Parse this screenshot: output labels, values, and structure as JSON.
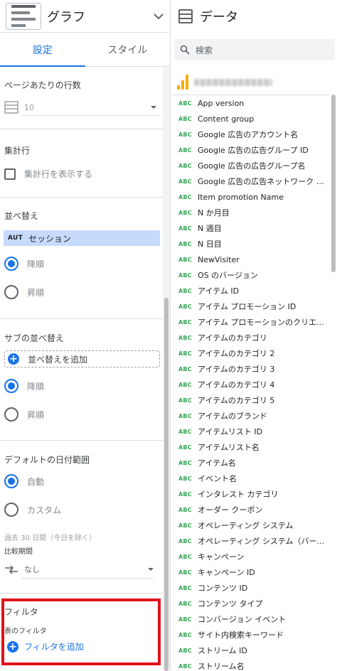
{
  "header": {
    "title": "グラフ"
  },
  "tabs": [
    {
      "label": "設定"
    },
    {
      "label": "スタイル"
    }
  ],
  "rows_per_page": {
    "label": "ページあたりの行数",
    "value": "10"
  },
  "summary_row": {
    "label": "集計行",
    "checkbox_label": "集計行を表示する"
  },
  "sort": {
    "label": "並べ替え",
    "chip_type": "AUT",
    "chip_label": "セッション",
    "desc": "降順",
    "asc": "昇順",
    "selected": "desc"
  },
  "secondary_sort": {
    "label": "サブの並べ替え",
    "add_label": "並べ替えを追加",
    "desc": "降順",
    "asc": "昇順",
    "selected": "desc"
  },
  "date_range": {
    "label": "デフォルトの日付範囲",
    "auto": "自動",
    "custom": "カスタム",
    "selected": "auto",
    "hint": "過去 30 日間（今日を除く）",
    "compare_label": "比較期間",
    "compare_value": "なし"
  },
  "filter": {
    "label": "フィルタ",
    "sub_label": "表のフィルタ",
    "add_label": "フィルタを追加"
  },
  "data_panel": {
    "title": "データ",
    "search_placeholder": "検索",
    "field_type": "ABC",
    "fields": [
      "App version",
      "Content group",
      "Google 広告のアカウント名",
      "Google 広告の広告グループ ID",
      "Google 広告の広告グループ名",
      "Google 広告の広告ネットワーク タ...",
      "Item promotion Name",
      "N か月目",
      "N 週目",
      "N 日目",
      "NewVisiter",
      "OS のバージョン",
      "アイテム ID",
      "アイテム プロモーション ID",
      "アイテム プロモーションのクリエ...",
      "アイテムのカテゴリ",
      "アイテムのカテゴリ 2",
      "アイテムのカテゴリ 3",
      "アイテムのカテゴリ 4",
      "アイテムのカテゴリ 5",
      "アイテムのブランド",
      "アイテムリスト ID",
      "アイテムリスト名",
      "アイテム名",
      "イベント名",
      "インタレスト カテゴリ",
      "オーダー クーポン",
      "オペレーティング システム",
      "オペレーティング システム（バー...",
      "キャンペーン",
      "キャンペーン ID",
      "コンテンツ ID",
      "コンテンツ タイプ",
      "コンバージョン イベント",
      "サイト内検索キーワード",
      "ストリーム ID",
      "ストリーム名"
    ]
  },
  "colors": {
    "accent": "#1a73e8",
    "highlight_box": "#e0121a",
    "chip_bg": "#c6dafc",
    "field_type": "#34a853",
    "source_icon": "#f9ab00"
  }
}
